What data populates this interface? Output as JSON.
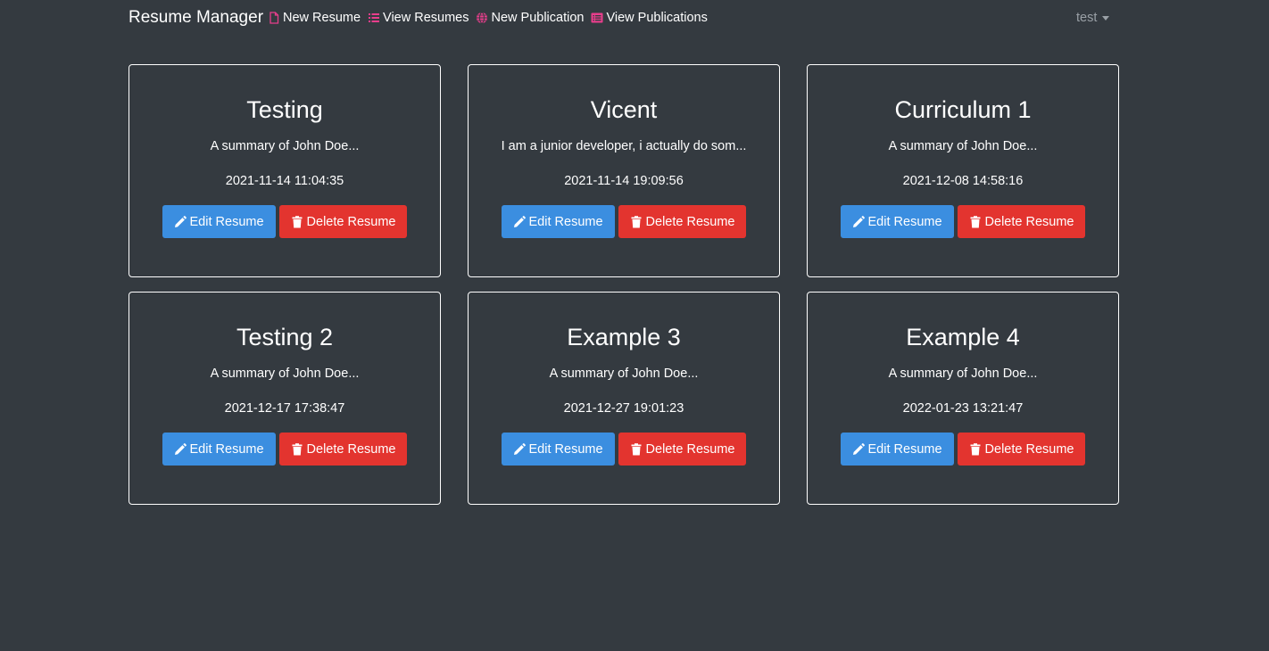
{
  "app": {
    "brand": "Resume Manager"
  },
  "nav": {
    "items": [
      {
        "label": "New Resume",
        "icon": "file-icon"
      },
      {
        "label": "View Resumes",
        "icon": "list-icon"
      },
      {
        "label": "New Publication",
        "icon": "globe-icon"
      },
      {
        "label": "View Publications",
        "icon": "list-alt-icon"
      }
    ],
    "icon_color": "#e83e8c",
    "user": "test"
  },
  "colors": {
    "background": "#343a40",
    "edit_button": "#3b8ee0",
    "delete_button": "#e3342f"
  },
  "resumes": [
    {
      "title": "Testing",
      "summary": "A summary of John Doe...",
      "date": "2021-11-14 11:04:35",
      "edit_label": "Edit Resume",
      "delete_label": "Delete Resume"
    },
    {
      "title": "Vicent",
      "summary": "I am a junior developer, i actually do som...",
      "date": "2021-11-14 19:09:56",
      "edit_label": "Edit Resume",
      "delete_label": "Delete Resume"
    },
    {
      "title": "Curriculum 1",
      "summary": "A summary of John Doe...",
      "date": "2021-12-08 14:58:16",
      "edit_label": "Edit Resume",
      "delete_label": "Delete Resume"
    },
    {
      "title": "Testing 2",
      "summary": "A summary of John Doe...",
      "date": "2021-12-17 17:38:47",
      "edit_label": "Edit Resume",
      "delete_label": "Delete Resume"
    },
    {
      "title": "Example 3",
      "summary": "A summary of John Doe...",
      "date": "2021-12-27 19:01:23",
      "edit_label": "Edit Resume",
      "delete_label": "Delete Resume"
    },
    {
      "title": "Example 4",
      "summary": "A summary of John Doe...",
      "date": "2022-01-23 13:21:47",
      "edit_label": "Edit Resume",
      "delete_label": "Delete Resume"
    }
  ]
}
